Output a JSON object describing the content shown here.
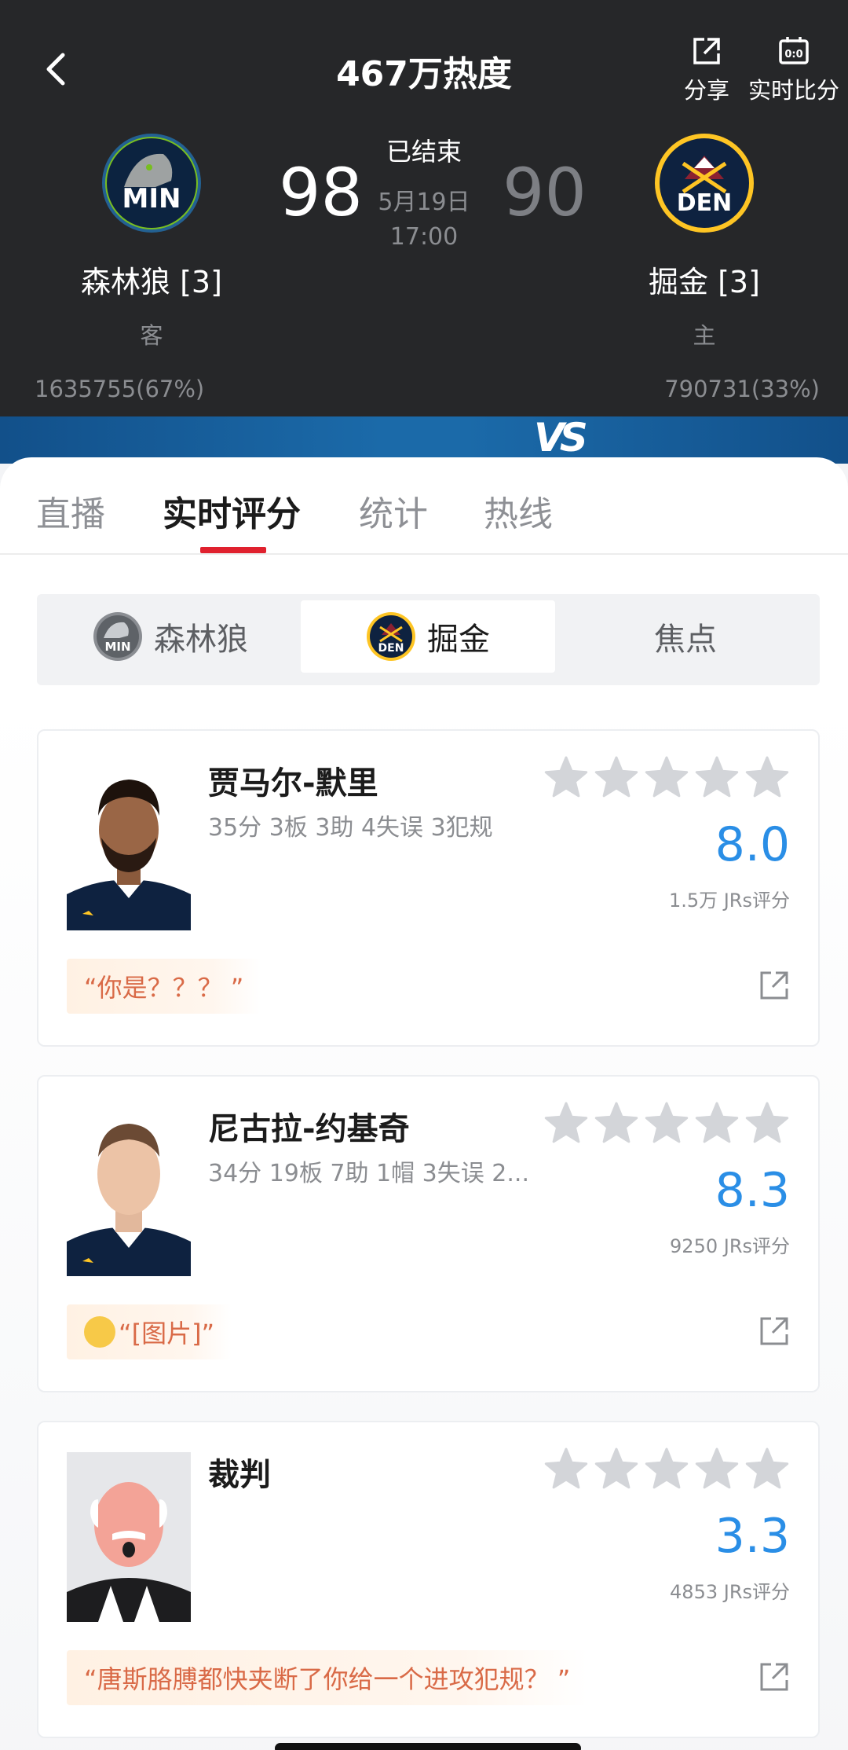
{
  "header": {
    "hot_title": "467万热度",
    "share_label": "分享",
    "live_score_label": "实时比分",
    "status": "已结束",
    "date": "5月19日",
    "time": "17:00"
  },
  "away_team": {
    "abbr": "MIN",
    "name": "森林狼 [3]",
    "side": "客",
    "score": "98",
    "support": "1635755(67%)"
  },
  "home_team": {
    "abbr": "DEN",
    "name": "掘金 [3]",
    "side": "主",
    "score": "90",
    "support": "790731(33%)"
  },
  "vs_label": "VS",
  "tabs": [
    {
      "label": "直播"
    },
    {
      "label": "实时评分"
    },
    {
      "label": "统计"
    },
    {
      "label": "热线"
    }
  ],
  "active_tab": "实时评分",
  "segment": {
    "items": [
      {
        "label": "森林狼"
      },
      {
        "label": "掘金"
      },
      {
        "label": "焦点"
      }
    ],
    "active": "掘金"
  },
  "cards": [
    {
      "name": "贾马尔-默里",
      "stats": "35分 3板 3助 4失误 3犯规",
      "rating": "8.0",
      "jrs_count": "1.5万 JRs评分",
      "quote": "“你是？？？ ”",
      "stars": 5
    },
    {
      "name": "尼古拉-约基奇",
      "stats": "34分 19板 7助 1帽 3失误 2...",
      "rating": "8.3",
      "jrs_count": "9250 JRs评分",
      "quote": "“[图片]”",
      "stars": 5
    },
    {
      "name": "裁判",
      "stats": "",
      "rating": "3.3",
      "jrs_count": "4853 JRs评分",
      "quote": "“唐斯胳膊都快夹断了你给一个进攻犯规？ ”",
      "stars": 5
    }
  ],
  "colors": {
    "header_bg": "#262729",
    "accent_red": "#e0212e",
    "rating_blue": "#2a8ee6",
    "quote_orange": "#d96a47"
  }
}
